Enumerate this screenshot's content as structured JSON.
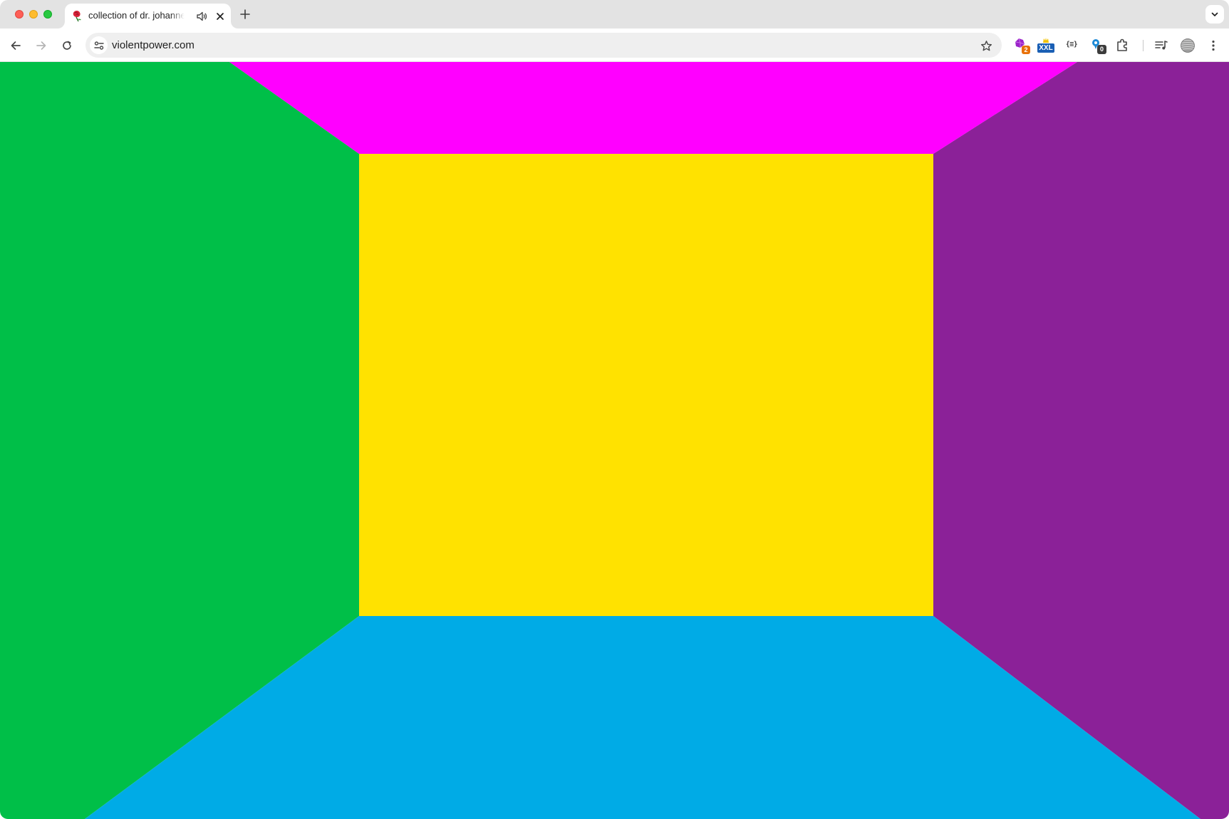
{
  "tab": {
    "title": "collection of dr. johannes",
    "favicon": "red-rose-icon",
    "audio_icon": "speaker-icon",
    "close_icon": "close-icon"
  },
  "toolbar": {
    "url": "violentpower.com",
    "extensions": [
      {
        "icon": "puzzle-gem-extension-icon",
        "badge": "2"
      },
      {
        "icon": "xxl-extension-icon",
        "label": "XXL"
      },
      {
        "icon": "json-extension-icon",
        "label": "{≡}"
      },
      {
        "icon": "blue-bubble-extension-icon",
        "badge": "0"
      }
    ]
  },
  "page": {
    "colors": {
      "left_wall": "#00bf48",
      "right_wall": "#8b2198",
      "ceiling": "#ff00ff",
      "back_wall": "#ffe200",
      "floor": "#00abe6"
    }
  }
}
